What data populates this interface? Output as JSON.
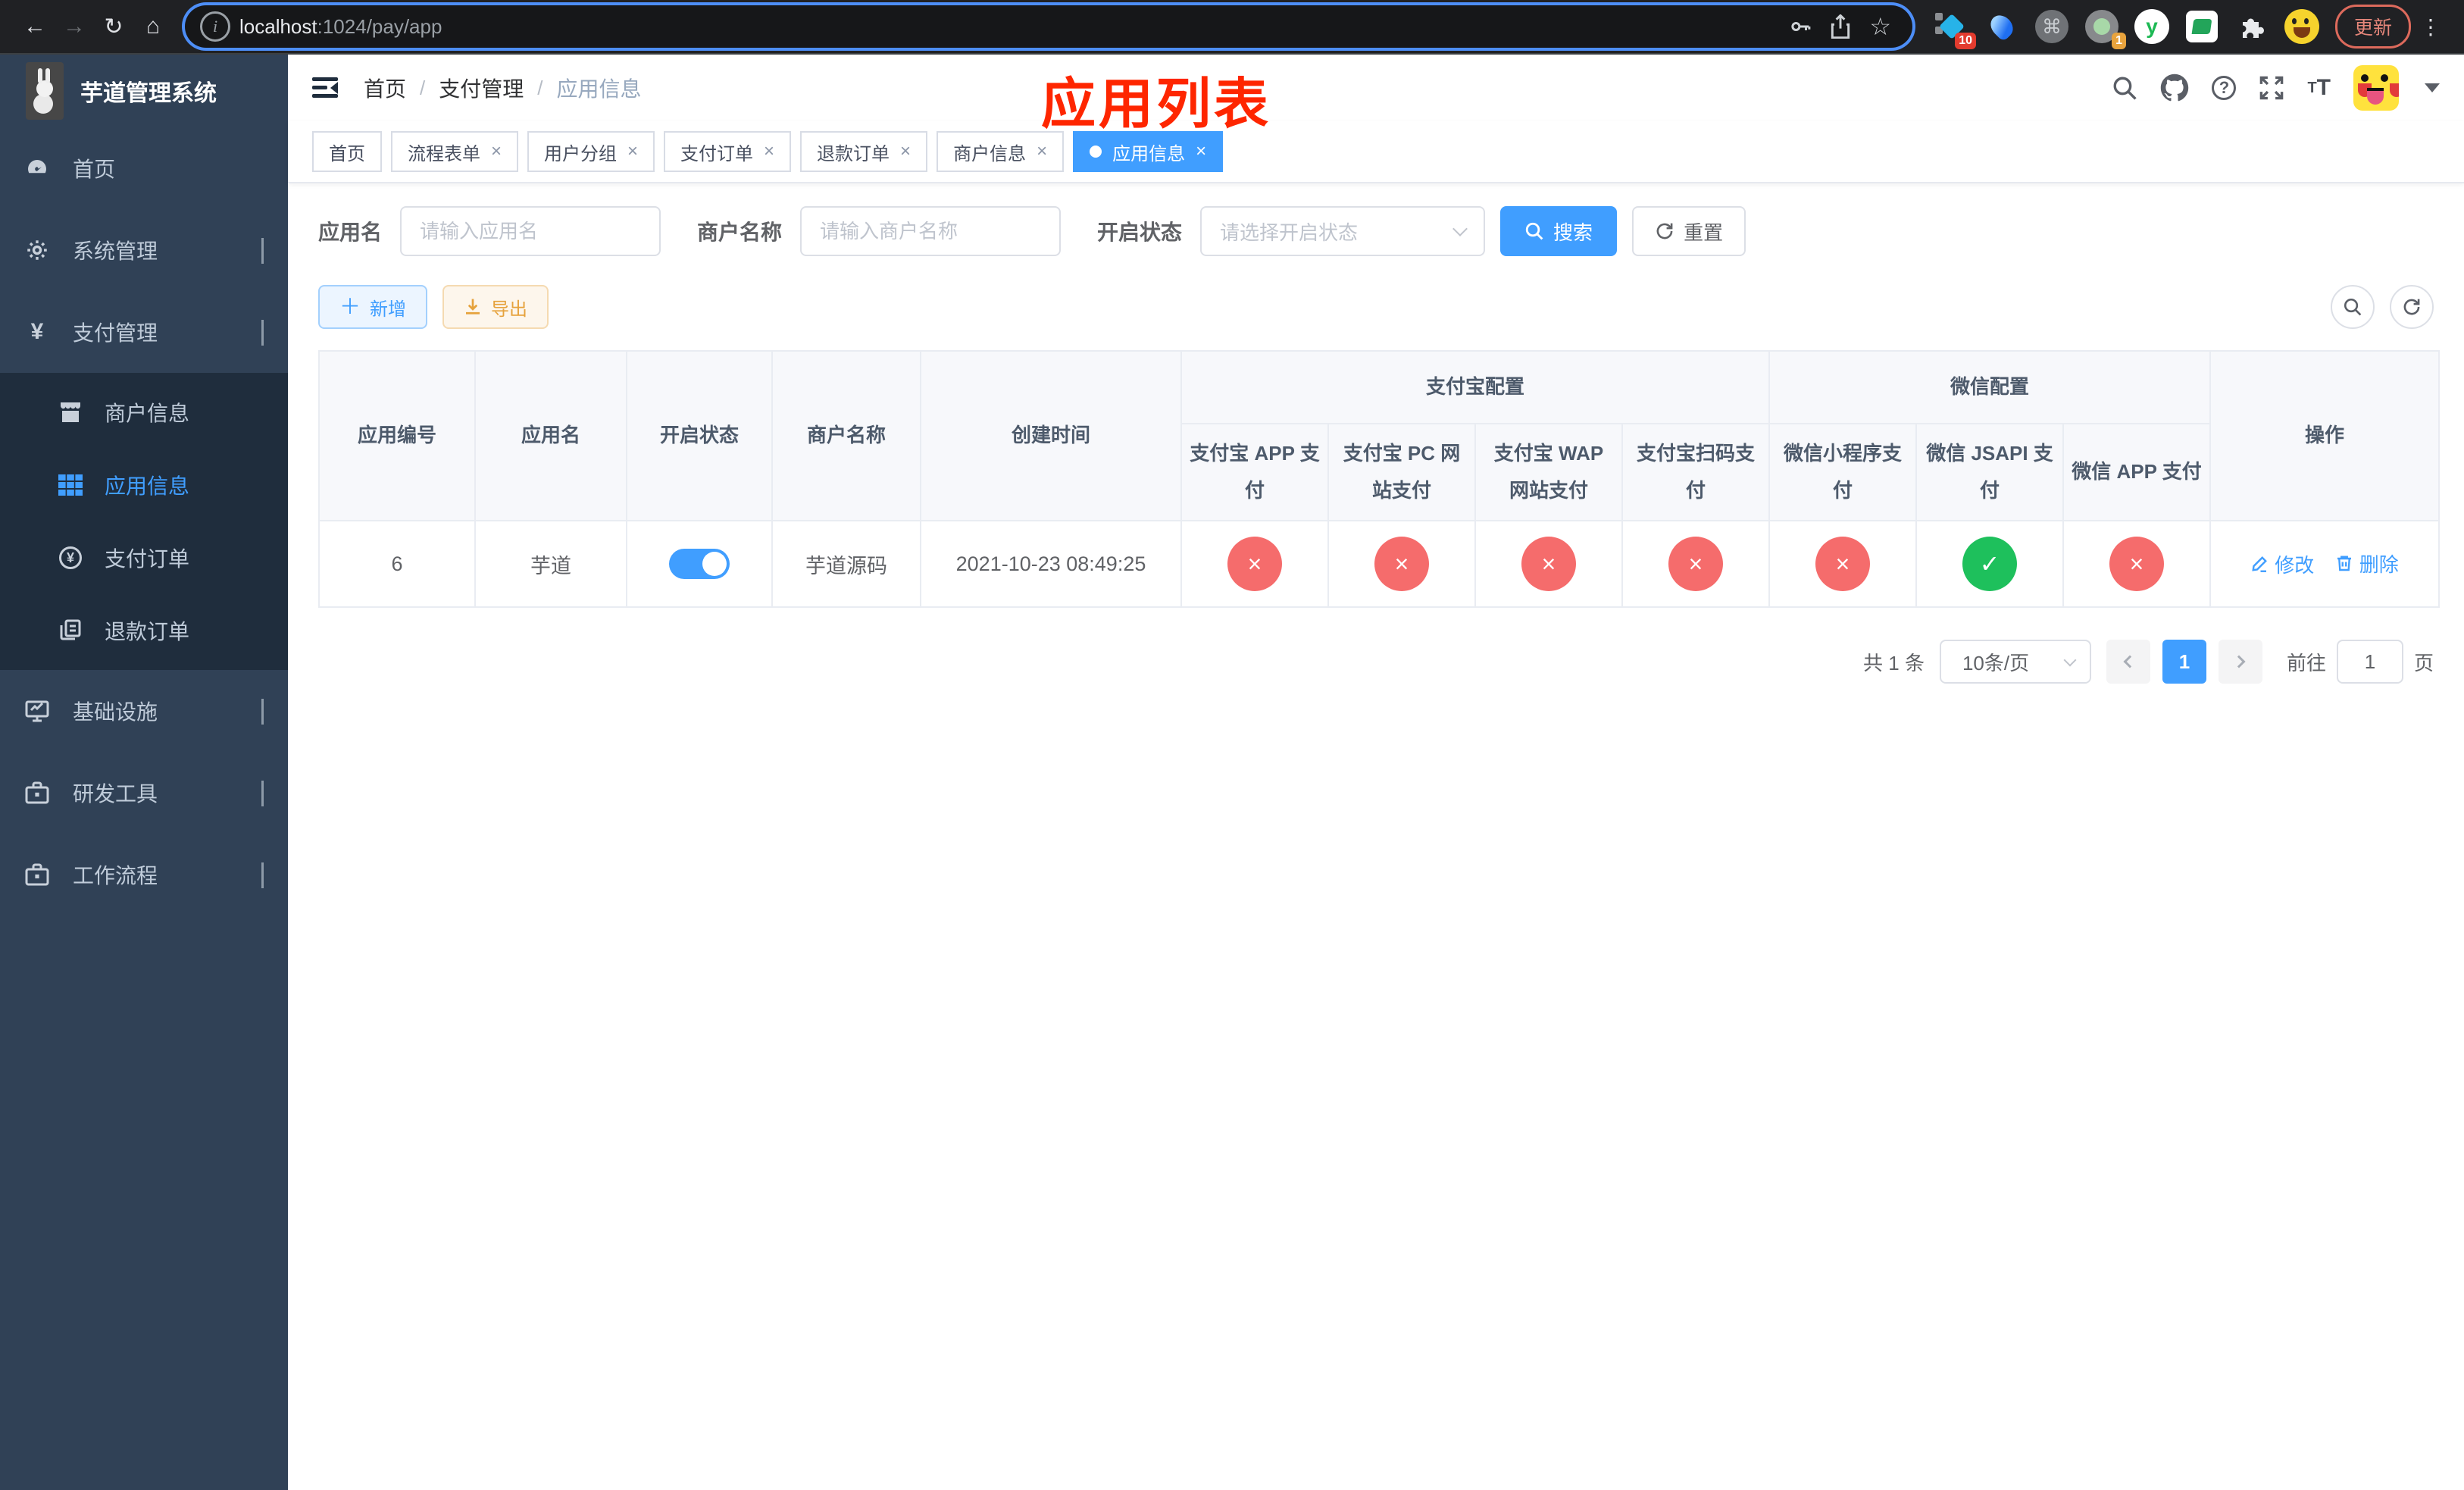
{
  "colors": {
    "accent": "#409eff",
    "danger": "#f56c6c",
    "success": "#1ec05c",
    "warning": "#e6a23c",
    "annotation": "#fe2600",
    "sidebar_bg": "#304156",
    "submenu_bg": "#1f2d3d"
  },
  "icons": {
    "back": "←",
    "forward": "→",
    "reload": "↻",
    "home": "⌂",
    "info": "i",
    "star": "☆",
    "cmd": "⌘",
    "kebab": "⋮",
    "question": "?",
    "check": "✓",
    "cross": "×",
    "close": "×",
    "y_logo": "y",
    "font_size_small": "T",
    "font_size_big": "T"
  },
  "browser": {
    "url_host": "localhost",
    "url_path": ":1024/pay/app",
    "update_label": "更新",
    "ext_badge_duplicate": "10",
    "ext_badge_recorder": "1"
  },
  "sidebar": {
    "title": "芋道管理系统",
    "menu": [
      {
        "label": "首页"
      },
      {
        "label": "系统管理"
      },
      {
        "label": "支付管理"
      },
      {
        "label": "商户信息"
      },
      {
        "label": "应用信息"
      },
      {
        "label": "支付订单"
      },
      {
        "label": "退款订单"
      },
      {
        "label": "基础设施"
      },
      {
        "label": "研发工具"
      },
      {
        "label": "工作流程"
      }
    ]
  },
  "header": {
    "breadcrumb": [
      "首页",
      "支付管理",
      "应用信息"
    ],
    "annotation": "应用列表"
  },
  "tabs": [
    {
      "label": "首页"
    },
    {
      "label": "流程表单"
    },
    {
      "label": "用户分组"
    },
    {
      "label": "支付订单"
    },
    {
      "label": "退款订单"
    },
    {
      "label": "商户信息"
    },
    {
      "label": "应用信息"
    }
  ],
  "filters": {
    "app_name_label": "应用名",
    "app_name_placeholder": "请输入应用名",
    "merchant_label": "商户名称",
    "merchant_placeholder": "请输入商户名称",
    "status_label": "开启状态",
    "status_placeholder": "请选择开启状态",
    "search_label": "搜索",
    "reset_label": "重置"
  },
  "toolbar": {
    "add_label": "新增",
    "export_label": "导出"
  },
  "table": {
    "group_headers": {
      "alipay": "支付宝配置",
      "wechat": "微信配置"
    },
    "columns": [
      "应用编号",
      "应用名",
      "开启状态",
      "商户名称",
      "创建时间",
      "支付宝 APP 支付",
      "支付宝 PC 网站支付",
      "支付宝 WAP 网站支付",
      "支付宝扫码支付",
      "微信小程序支付",
      "微信 JSAPI 支付",
      "微信 APP 支付",
      "操作"
    ],
    "rows": [
      {
        "app_id": "6",
        "app_name": "芋道",
        "status_on": true,
        "merchant_name": "芋道源码",
        "create_time": "2021-10-23 08:49:25",
        "configs": [
          "fail",
          "fail",
          "fail",
          "fail",
          "fail",
          "success",
          "fail"
        ]
      }
    ],
    "actions": {
      "edit": "修改",
      "delete": "删除"
    }
  },
  "pagination": {
    "total": "共 1 条",
    "page_size": "10条/页",
    "current_page": "1",
    "goto_label": "前往",
    "goto_value": "1",
    "page_unit": "页"
  }
}
